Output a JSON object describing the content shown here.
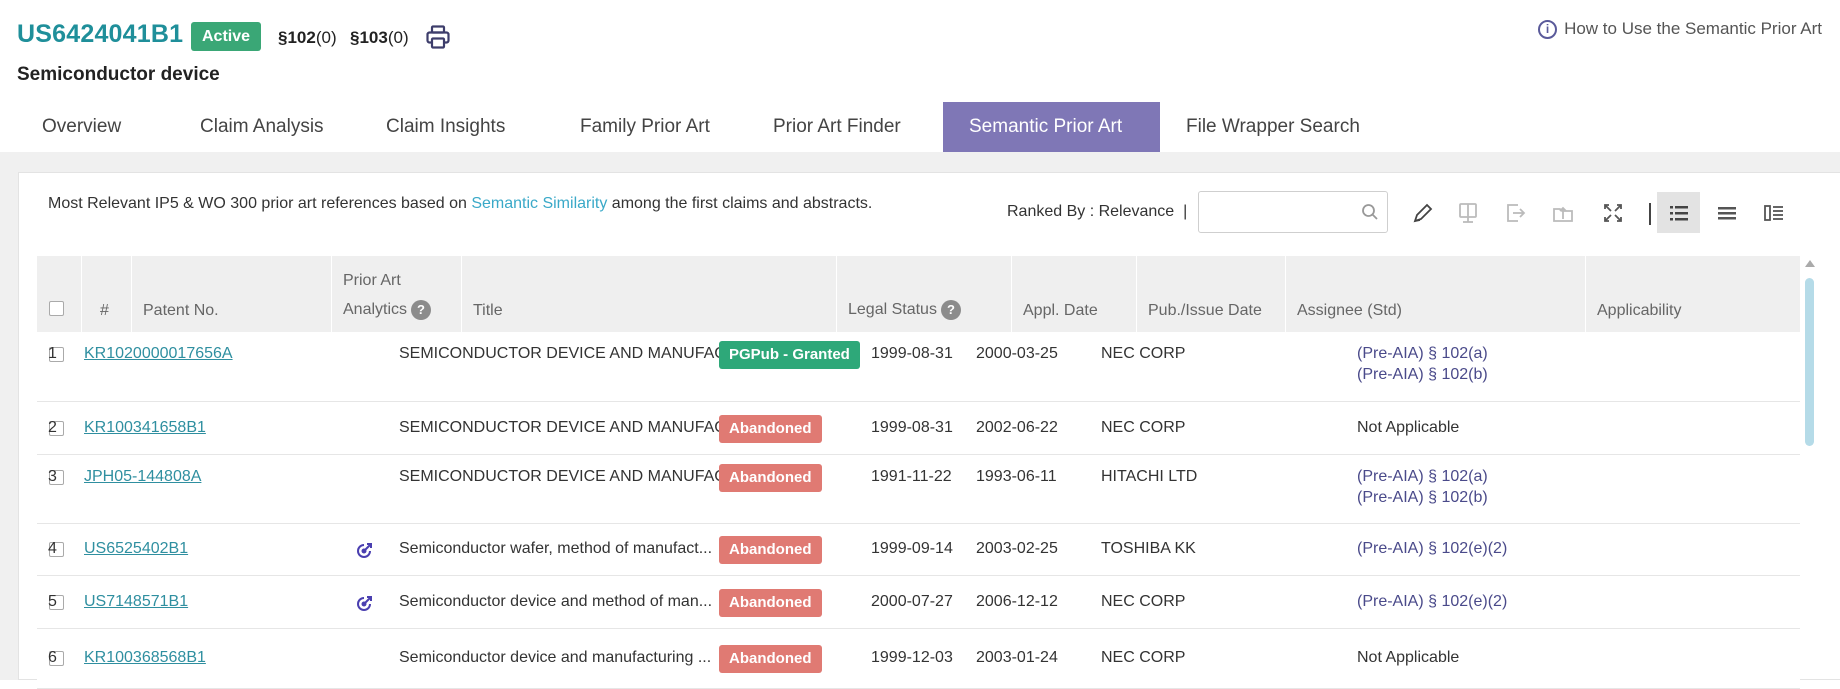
{
  "header": {
    "patent_id": "US6424041B1",
    "status_badge": "Active",
    "sec102_label": "§102",
    "sec102_count": "(0)",
    "sec103_label": "§103",
    "sec103_count": "(0)",
    "help_link": "How to Use the Semantic Prior Art",
    "title": "Semiconductor device"
  },
  "tabs": [
    {
      "label": "Overview"
    },
    {
      "label": "Claim Analysis"
    },
    {
      "label": "Claim Insights"
    },
    {
      "label": "Family Prior Art"
    },
    {
      "label": "Prior Art Finder"
    },
    {
      "label": "Semantic Prior Art",
      "active": true
    },
    {
      "label": "File Wrapper Search"
    }
  ],
  "toolbar": {
    "desc_before": "Most Relevant IP5 & WO 300 prior art references based on ",
    "desc_link": "Semantic Similarity",
    "desc_after": " among the first claims and abstracts.",
    "ranked_by": "Ranked By : Relevance",
    "ranked_sep": "|",
    "search_placeholder": "",
    "search_value": ""
  },
  "table": {
    "headers": {
      "num": "#",
      "patent_no": "Patent No.",
      "analytics_line1": "Prior Art",
      "analytics_line2": "Analytics",
      "title": "Title",
      "legal_status": "Legal Status",
      "appl_date": "Appl. Date",
      "pub_date": "Pub./Issue Date",
      "assignee": "Assignee (Std)",
      "applicability": "Applicability"
    },
    "help_glyph": "?",
    "rows": [
      {
        "num": "1",
        "patent_no": "KR1020000017656A",
        "has_analytics": false,
        "title": "SEMICONDUCTOR DEVICE AND MANUFAC...",
        "status": "PGPub - Granted",
        "status_type": "granted",
        "appl_date": "1999-08-31",
        "pub_date": "2000-03-25",
        "assignee": "NEC CORP",
        "applicability": [
          "(Pre-AIA) § 102(a)",
          "(Pre-AIA) § 102(b)"
        ]
      },
      {
        "num": "2",
        "patent_no": "KR100341658B1",
        "has_analytics": false,
        "title": "SEMICONDUCTOR DEVICE AND MANUFAC...",
        "status": "Abandoned",
        "status_type": "abandoned",
        "appl_date": "1999-08-31",
        "pub_date": "2002-06-22",
        "assignee": "NEC CORP",
        "applicability": [
          "Not Applicable"
        ]
      },
      {
        "num": "3",
        "patent_no": "JPH05-144808A",
        "has_analytics": false,
        "title": "SEMICONDUCTOR DEVICE AND MANUFAC...",
        "status": "Abandoned",
        "status_type": "abandoned",
        "appl_date": "1991-11-22",
        "pub_date": "1993-06-11",
        "assignee": "HITACHI LTD",
        "applicability": [
          "(Pre-AIA) § 102(a)",
          "(Pre-AIA) § 102(b)"
        ]
      },
      {
        "num": "4",
        "patent_no": "US6525402B1",
        "has_analytics": true,
        "title": "Semiconductor wafer, method of manufact...",
        "status": "Abandoned",
        "status_type": "abandoned",
        "appl_date": "1999-09-14",
        "pub_date": "2003-02-25",
        "assignee": "TOSHIBA KK",
        "applicability": [
          "(Pre-AIA) § 102(e)(2)"
        ]
      },
      {
        "num": "5",
        "patent_no": "US7148571B1",
        "has_analytics": true,
        "title": "Semiconductor device and method of man...",
        "status": "Abandoned",
        "status_type": "abandoned",
        "appl_date": "2000-07-27",
        "pub_date": "2006-12-12",
        "assignee": "NEC CORP",
        "applicability": [
          "(Pre-AIA) § 102(e)(2)"
        ]
      },
      {
        "num": "6",
        "patent_no": "KR100368568B1",
        "has_analytics": false,
        "title": "Semiconductor device and manufacturing ...",
        "status": "Abandoned",
        "status_type": "abandoned",
        "appl_date": "1999-12-03",
        "pub_date": "2003-01-24",
        "assignee": "NEC CORP",
        "applicability": [
          "Not Applicable"
        ]
      }
    ]
  },
  "colors": {
    "accent_tab": "#7f77b6",
    "patent_id": "#1f8f9a",
    "active_badge": "#3aa776",
    "granted": "#2ea879",
    "abandoned": "#e07a73",
    "link": "#2f8fa0",
    "applicability_link": "#4a4a8a"
  },
  "icons": {
    "print": "print-icon",
    "info": "info-icon",
    "search": "search-icon",
    "tools": [
      "edit-icon",
      "monitor-icon",
      "export-icon",
      "upload-icon",
      "expand-icon",
      "list-view-icon",
      "compact-view-icon",
      "detail-view-icon"
    ],
    "analytics": "analytics-icon"
  }
}
